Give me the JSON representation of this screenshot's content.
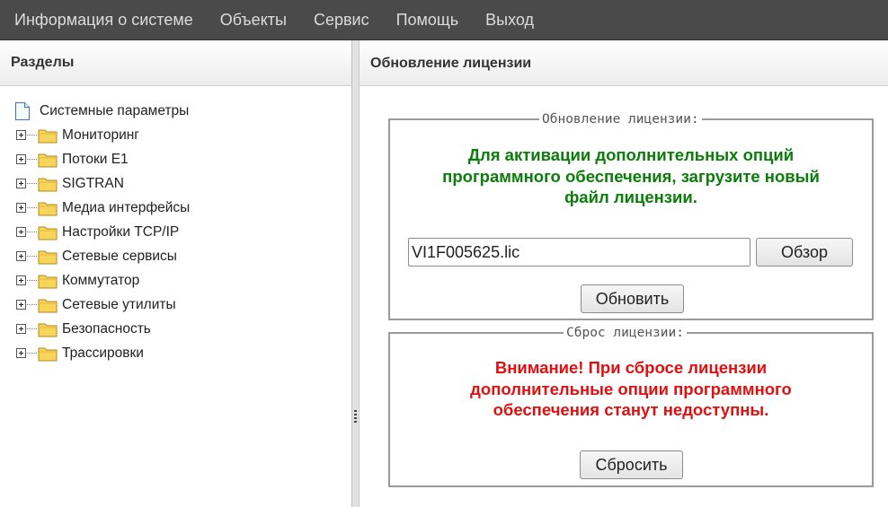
{
  "menu": [
    "Информация о системе",
    "Объекты",
    "Сервис",
    "Помощь",
    "Выход"
  ],
  "left": {
    "header": "Разделы",
    "root": "Системные параметры",
    "items": [
      "Мониторинг",
      "Потоки E1",
      "SIGTRAN",
      "Медиа интерфейсы",
      "Настройки TCP/IP",
      "Сетевые сервисы",
      "Коммутатор",
      "Сетевые утилиты",
      "Безопасность",
      "Трассировки"
    ]
  },
  "right": {
    "header": "Обновление лицензии",
    "update": {
      "legend": "Обновление лицензии:",
      "message": "Для активации дополнительных опций программного обеспечения, загрузите новый файл лицензии.",
      "file_value": "VI1F005625.lic",
      "browse_label": "Обзор",
      "update_label": "Обновить"
    },
    "reset": {
      "legend": "Сброс лицензии:",
      "message": "Внимание! При сбросе лицензии дополнительные опции программного обеспечения станут недоступны.",
      "reset_label": "Сбросить"
    }
  },
  "colors": {
    "menubar": "#4a4a4a",
    "green_text": "#0a7d0a",
    "red_text": "#e01010"
  },
  "icons": {
    "root": "document-icon",
    "expand": "plus-box-icon",
    "folder": "folder-icon"
  }
}
